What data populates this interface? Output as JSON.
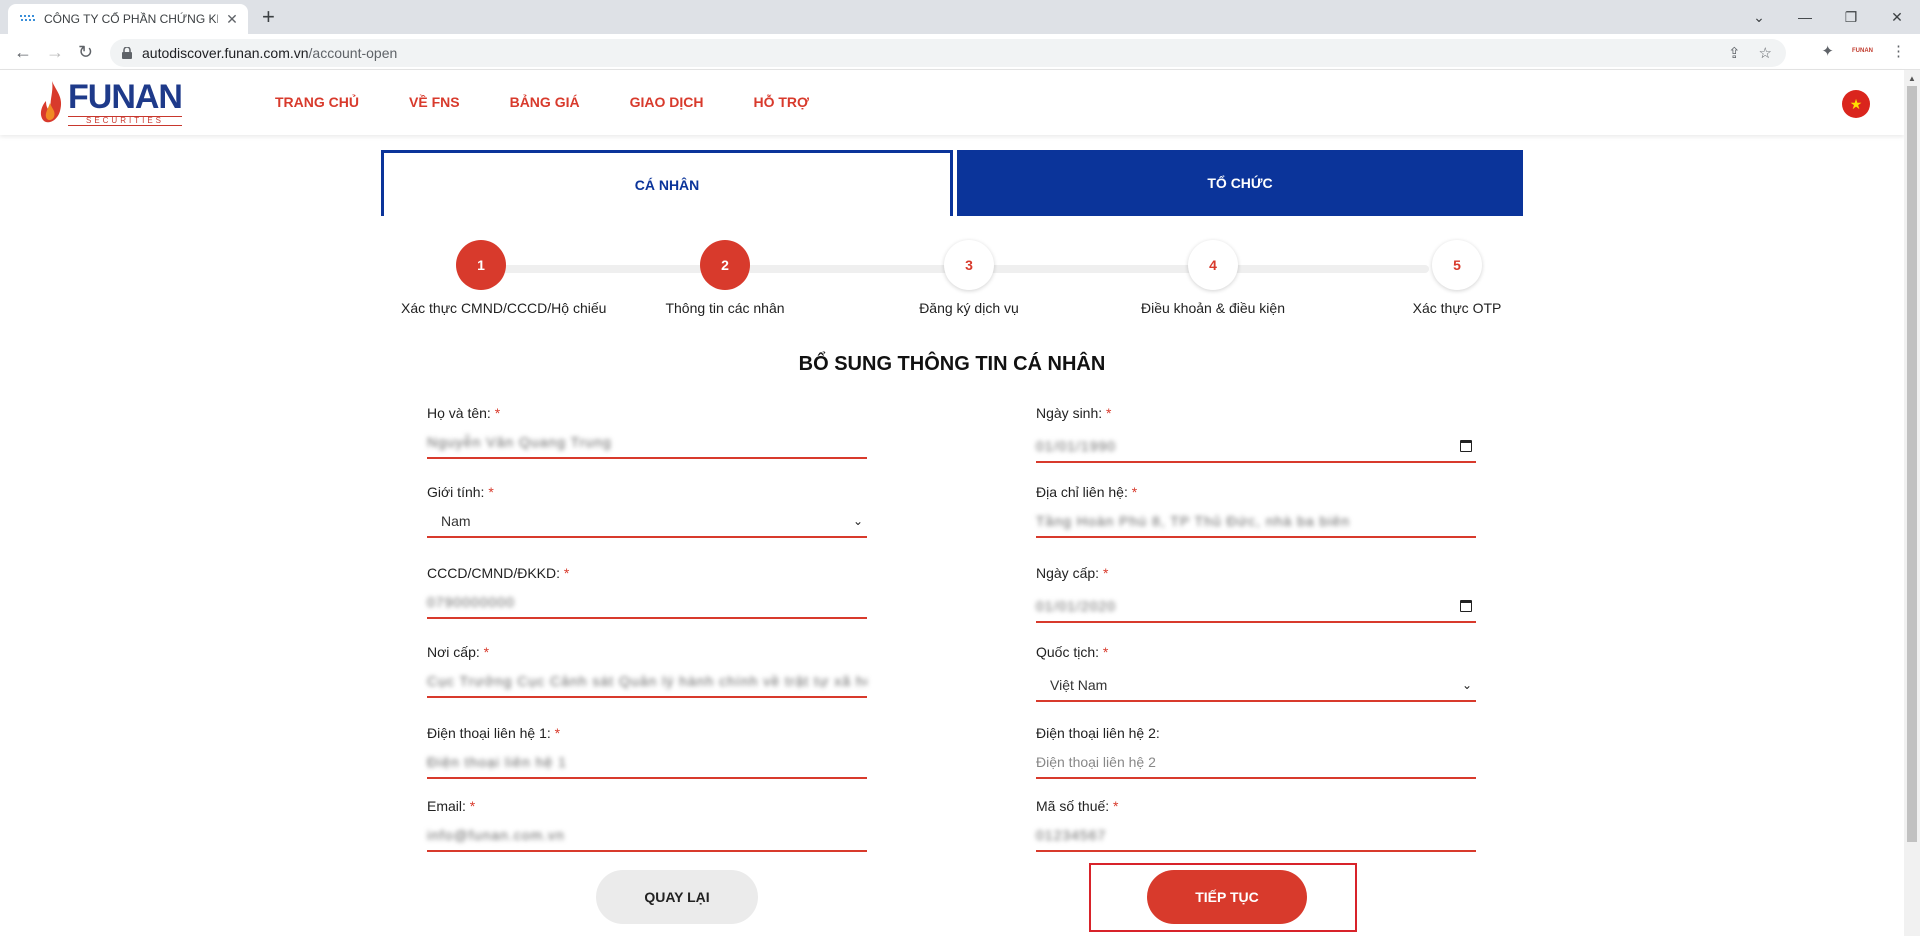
{
  "browser": {
    "tab_title": "CÔNG TY CỔ PHẦN CHỨNG KHO",
    "url_domain": "autodiscover.funan.com.vn",
    "url_path": "/account-open",
    "ext_label": "FUNAN"
  },
  "site": {
    "logo_main": "FUNAN",
    "logo_sub": "SECURITIES",
    "nav": [
      "TRANG CHỦ",
      "VỀ FNS",
      "BẢNG GIÁ",
      "GIAO DỊCH",
      "HỖ TRỢ"
    ]
  },
  "account_tabs": {
    "individual": "CÁ NHÂN",
    "organization": "TỔ CHỨC"
  },
  "steps": [
    {
      "num": "1",
      "label": "Xác thực CMND/CCCD/Hộ chiếu",
      "state": "done"
    },
    {
      "num": "2",
      "label": "Thông tin các nhân",
      "state": "done"
    },
    {
      "num": "3",
      "label": "Đăng ký dịch vụ",
      "state": "todo"
    },
    {
      "num": "4",
      "label": "Điều khoản & điều kiện",
      "state": "todo"
    },
    {
      "num": "5",
      "label": "Xác thực OTP",
      "state": "todo"
    }
  ],
  "form": {
    "title": "BỔ SUNG THÔNG TIN CÁ NHÂN",
    "full_name": {
      "label": "Họ và tên:",
      "required": "*",
      "value": "Nguyễn Văn Quang Trung"
    },
    "birth_date": {
      "label": "Ngày sinh:",
      "required": "*",
      "value": "01/01/1990"
    },
    "gender": {
      "label": "Giới tính:",
      "required": "*",
      "value": "Nam"
    },
    "address": {
      "label": "Địa chỉ liên hệ:",
      "required": "*",
      "value": "Tầng Hoàn Phú 8, TP Thủ Đức, nhà ba biên"
    },
    "id_number": {
      "label": "CCCD/CMND/ĐKKD:",
      "required": "*",
      "value": "0790000000"
    },
    "issue_date": {
      "label": "Ngày cấp:",
      "required": "*",
      "value": "01/01/2020"
    },
    "issue_place": {
      "label": "Nơi cấp:",
      "required": "*",
      "value": "Cục Trưởng Cục Cảnh sát Quản lý hành chính về trật tự xã hội"
    },
    "nationality": {
      "label": "Quốc tịch:",
      "required": "*",
      "value": "Việt Nam"
    },
    "phone1": {
      "label": "Điện thoại liên hệ 1:",
      "required": "*",
      "value": "Điện thoại liên hệ 1"
    },
    "phone2": {
      "label": "Điện thoại liên hệ 2:",
      "placeholder": "Điện thoại liên hệ 2"
    },
    "email": {
      "label": "Email:",
      "required": "*",
      "value": "info@funan.com.vn"
    },
    "tax_code": {
      "label": "Mã số thuế:",
      "required": "*",
      "value": "01234567"
    }
  },
  "buttons": {
    "back": "QUAY LẠI",
    "next": "TIẾP TỤC"
  },
  "colors": {
    "brand_red": "#d83a2c",
    "brand_blue": "#0b349a"
  }
}
